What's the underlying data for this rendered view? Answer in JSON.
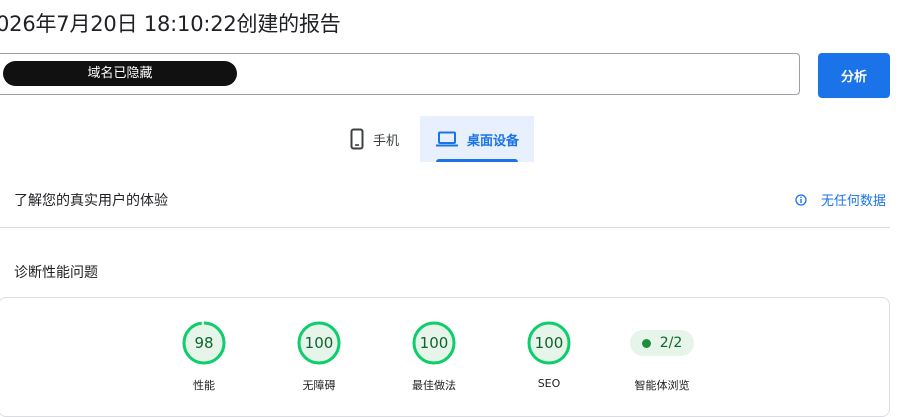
{
  "report": {
    "title": "026年7月20日 18:10:22创建的报告"
  },
  "url_input": {
    "masked_domain": "域名已隐藏"
  },
  "analyze_button": {
    "label": "分析"
  },
  "device_tabs": [
    {
      "label": "手机",
      "icon": "smartphone-icon",
      "selected": false
    },
    {
      "label": "桌面设备",
      "icon": "laptop-icon",
      "selected": true
    }
  ],
  "field_data": {
    "title": "了解您的真实用户的体验",
    "status": "无任何数据",
    "status_icon": "info-icon"
  },
  "diagnostics": {
    "title": "诊断性能问题",
    "scores": [
      {
        "label": "性能",
        "value": "98",
        "fraction": 0.98
      },
      {
        "label": "无障碍",
        "value": "100",
        "fraction": 1.0
      },
      {
        "label": "最佳做法",
        "value": "100",
        "fraction": 1.0
      },
      {
        "label": "SEO",
        "value": "100",
        "fraction": 1.0
      }
    ],
    "agentic": {
      "label": "智能体浏览",
      "value": "2/2"
    }
  },
  "colors": {
    "accent": "#1a73e8",
    "pass": "#0cce6b",
    "pass_text": "#0d652d",
    "pass_bg": "#e6f4ea"
  }
}
